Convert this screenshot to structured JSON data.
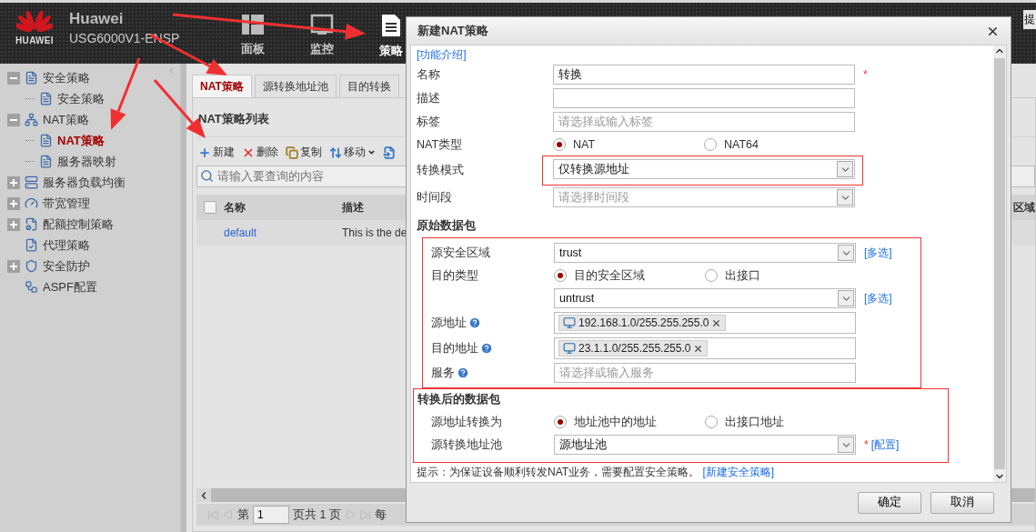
{
  "header": {
    "brand": "HUAWEI",
    "title": "Huawei",
    "model": "USG6000V1-ENSP",
    "nav": [
      {
        "label": "面板",
        "selected": false
      },
      {
        "label": "监控",
        "selected": false
      },
      {
        "label": "策略",
        "selected": true
      }
    ],
    "right_text": "提"
  },
  "sidebar": {
    "items": [
      {
        "label": "安全策略",
        "kind": "folder",
        "expanded": true,
        "selected": false,
        "children": [
          {
            "label": "安全策略",
            "selected": false
          }
        ]
      },
      {
        "label": "NAT策略",
        "kind": "folder",
        "expanded": true,
        "selected": false,
        "children": [
          {
            "label": "NAT策略",
            "selected": true
          },
          {
            "label": "服务器映射",
            "selected": false
          }
        ]
      },
      {
        "label": "服务器负载均衡",
        "kind": "folder",
        "expanded": false,
        "selected": false
      },
      {
        "label": "带宽管理",
        "kind": "folder",
        "expanded": false,
        "selected": false
      },
      {
        "label": "配额控制策略",
        "kind": "folder",
        "expanded": false,
        "selected": false
      },
      {
        "label": "代理策略",
        "kind": "leaf",
        "selected": false
      },
      {
        "label": "安全防护",
        "kind": "folder",
        "expanded": false,
        "selected": false
      },
      {
        "label": "ASPF配置",
        "kind": "leaf",
        "selected": false
      }
    ]
  },
  "tabs": [
    {
      "label": "NAT策略",
      "selected": true
    },
    {
      "label": "源转换地址池",
      "selected": false
    },
    {
      "label": "目的转换",
      "selected": false
    }
  ],
  "panel": {
    "title": "NAT策略列表",
    "toolbar": [
      {
        "label": "新建",
        "kind": "add"
      },
      {
        "label": "删除",
        "kind": "delete"
      },
      {
        "label": "复制",
        "kind": "copy"
      },
      {
        "label": "移动",
        "kind": "move"
      },
      {
        "kind": "insert"
      }
    ],
    "search": {
      "placeholder": "请输入要查询的内容"
    },
    "table": {
      "select_all": false,
      "columns": [
        "名称",
        "描述",
        "区域"
      ],
      "rows": [
        {
          "name": "default",
          "description": "This is the de"
        }
      ]
    },
    "pager": {
      "prefix": "第",
      "page": "1",
      "suffix": "页共 1 页",
      "trailing": "每"
    }
  },
  "dialog": {
    "title": "新建NAT策略",
    "intro_link": "[功能介绍]",
    "rows": [
      {
        "kind": "input",
        "label": "名称",
        "value": "转换",
        "mark": "*"
      },
      {
        "kind": "input",
        "label": "描述"
      },
      {
        "kind": "input",
        "label": "标签",
        "placeholder": "请选择或输入标签"
      },
      {
        "kind": "radio",
        "label": "NAT类型",
        "options": [
          {
            "label": "NAT",
            "selected": true
          },
          {
            "label": "NAT64",
            "selected": false
          }
        ]
      },
      {
        "kind": "select",
        "label": "转换模式",
        "value": "仅转换源地址",
        "highlighted": true
      },
      {
        "kind": "select",
        "label": "时间段",
        "placeholder": "请选择时间段"
      }
    ],
    "sections": [
      {
        "title": "原始数据包",
        "highlighted": true,
        "title_boxed": false,
        "rows": [
          {
            "kind": "select",
            "label": "源安全区域",
            "value": "trust",
            "link": "[多选]"
          },
          {
            "kind": "radio",
            "label": "目的类型",
            "options": [
              {
                "label": "目的安全区域",
                "selected": true
              },
              {
                "label": "出接口",
                "selected": false
              }
            ]
          },
          {
            "kind": "select",
            "value": "untrust",
            "link": "[多选]"
          },
          {
            "kind": "tags",
            "label": "源地址",
            "help": true,
            "tags": [
              "192.168.1.0/255.255.255.0"
            ]
          },
          {
            "kind": "tags",
            "label": "目的地址",
            "help": true,
            "tags": [
              "23.1.1.0/255.255.255.0"
            ]
          },
          {
            "kind": "input",
            "label": "服务",
            "help": true,
            "placeholder": "请选择或输入服务"
          }
        ]
      },
      {
        "title": "转换后的数据包",
        "highlighted": true,
        "title_boxed": true,
        "rows": [
          {
            "kind": "radio",
            "label": "源地址转换为",
            "options": [
              {
                "label": "地址池中的地址",
                "selected": true
              },
              {
                "label": "出接口地址",
                "selected": false
              }
            ]
          },
          {
            "kind": "select",
            "label": "源转换地址池",
            "value": "源地址池",
            "mark": "*",
            "link": "[配置]"
          }
        ]
      }
    ],
    "hint": {
      "text": "提示：为保证设备顺利转发NAT业务，需要配置安全策略。",
      "link": "[新建安全策略]"
    },
    "buttons": [
      "确定",
      "取消"
    ]
  }
}
